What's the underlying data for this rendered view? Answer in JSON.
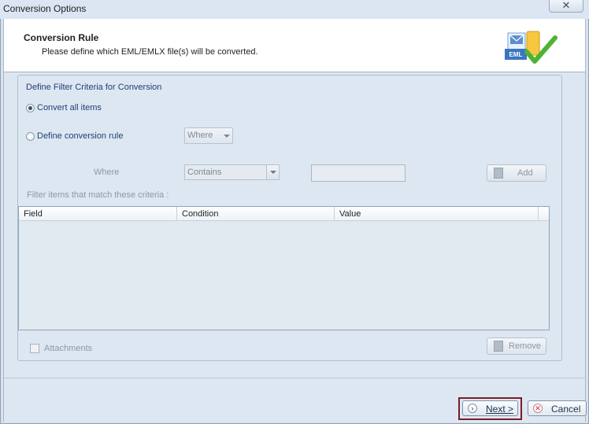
{
  "window": {
    "title": "Conversion Options",
    "close_glyph": "✕"
  },
  "header": {
    "title": "Conversion Rule",
    "subtitle": "Please define which EML/EMLX file(s) will be converted.",
    "icon": "eml-convert-icon",
    "icon_text": "EML"
  },
  "filter": {
    "legend": "Define Filter Criteria for Conversion",
    "convert_all_label": "Convert all items",
    "define_rule_label": "Define conversion rule",
    "where_button_label": "Where",
    "where_label": "Where",
    "condition_value": "Contains",
    "value_text": "",
    "add_label": "Add",
    "criteria_label": "Filter items that match these criteria :",
    "columns": [
      "Field",
      "Condition",
      "Value"
    ],
    "attachments_label": "Attachments",
    "remove_label": "Remove"
  },
  "footer": {
    "next_label": "Next >",
    "cancel_label": "Cancel"
  },
  "colors": {
    "highlight_border": "#7b1b2b",
    "legend_text": "#1e3f78"
  }
}
